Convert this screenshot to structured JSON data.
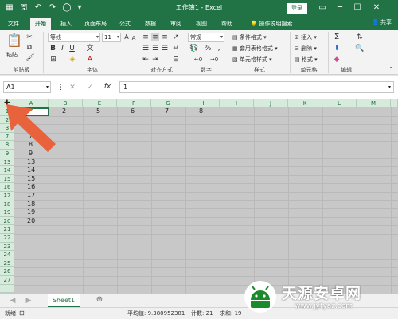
{
  "titlebar": {
    "title": "工作簿1 - Excel",
    "login": "登录"
  },
  "tabs": [
    "文件",
    "开始",
    "插入",
    "页面布局",
    "公式",
    "数据",
    "审阅",
    "视图",
    "帮助"
  ],
  "tell_me": "操作说明搜索",
  "share": "共享",
  "ribbon": {
    "paste": "粘贴",
    "font_name": "等线",
    "font_size": "11",
    "number_format": "常规",
    "number_percent": "%",
    "number_comma": ",",
    "cond_format": "条件格式",
    "table_format": "套用表格格式",
    "cell_style": "单元格样式",
    "insert": "插入",
    "delete": "删除",
    "format": "格式",
    "groups": {
      "clipboard": "剪贴板",
      "font": "字体",
      "alignment": "对齐方式",
      "number": "数字",
      "styles": "样式",
      "cells": "单元格",
      "editing": "编辑"
    }
  },
  "formula_bar": {
    "name_box": "A1",
    "fx": "fx",
    "value": "1"
  },
  "columns": [
    "A",
    "B",
    "E",
    "F",
    "G",
    "H",
    "I",
    "J",
    "K",
    "L",
    "M"
  ],
  "rows": [
    "1",
    "2",
    "3",
    "7",
    "8",
    "9",
    "13",
    "14",
    "15",
    "16",
    "17",
    "18",
    "19",
    "20",
    "21",
    "22",
    "23",
    "24",
    "25",
    "26",
    "27"
  ],
  "row1_values": {
    "B": "2",
    "E": "5",
    "F": "6",
    "G": "7",
    "H": "8"
  },
  "colA_values": [
    "",
    "",
    "",
    "7",
    "8",
    "9",
    "13",
    "14",
    "15",
    "16",
    "17",
    "18",
    "19",
    "20"
  ],
  "sheet_tab": "Sheet1",
  "status": {
    "ready": "就绪",
    "average": "平均值: 9.380952381",
    "count": "计数: 21",
    "sum": "求和: 19"
  },
  "watermark": {
    "brand": "天源安卓网",
    "url": "www.jytyaz.com"
  }
}
